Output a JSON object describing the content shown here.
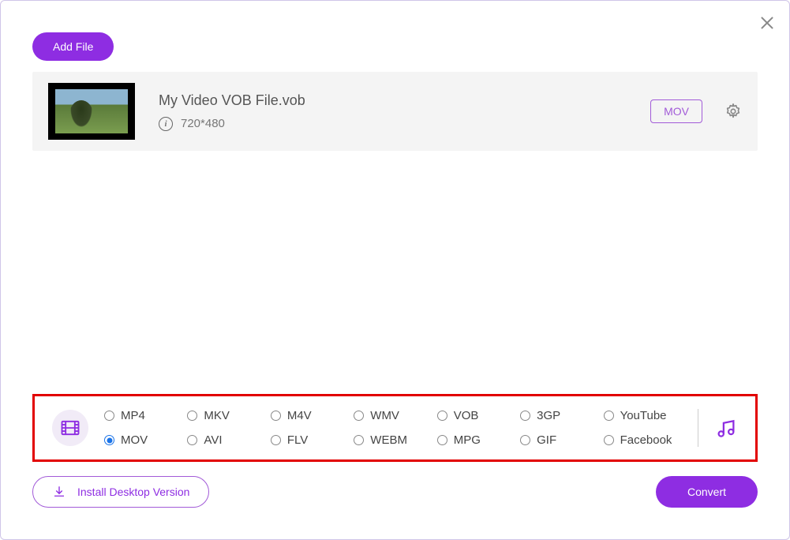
{
  "toolbar": {
    "add_file_label": "Add File"
  },
  "file": {
    "name": "My Video VOB File.vob",
    "resolution": "720*480",
    "output_format": "MOV"
  },
  "formats": {
    "selected": "MOV",
    "items": [
      "MP4",
      "MOV",
      "MKV",
      "AVI",
      "M4V",
      "FLV",
      "WMV",
      "WEBM",
      "VOB",
      "MPG",
      "3GP",
      "GIF",
      "YouTube",
      "Facebook"
    ]
  },
  "footer": {
    "install_label": "Install Desktop Version",
    "convert_label": "Convert"
  },
  "colors": {
    "primary": "#8e2de2",
    "highlight_border": "#e20000",
    "accent": "#a25bd8"
  }
}
